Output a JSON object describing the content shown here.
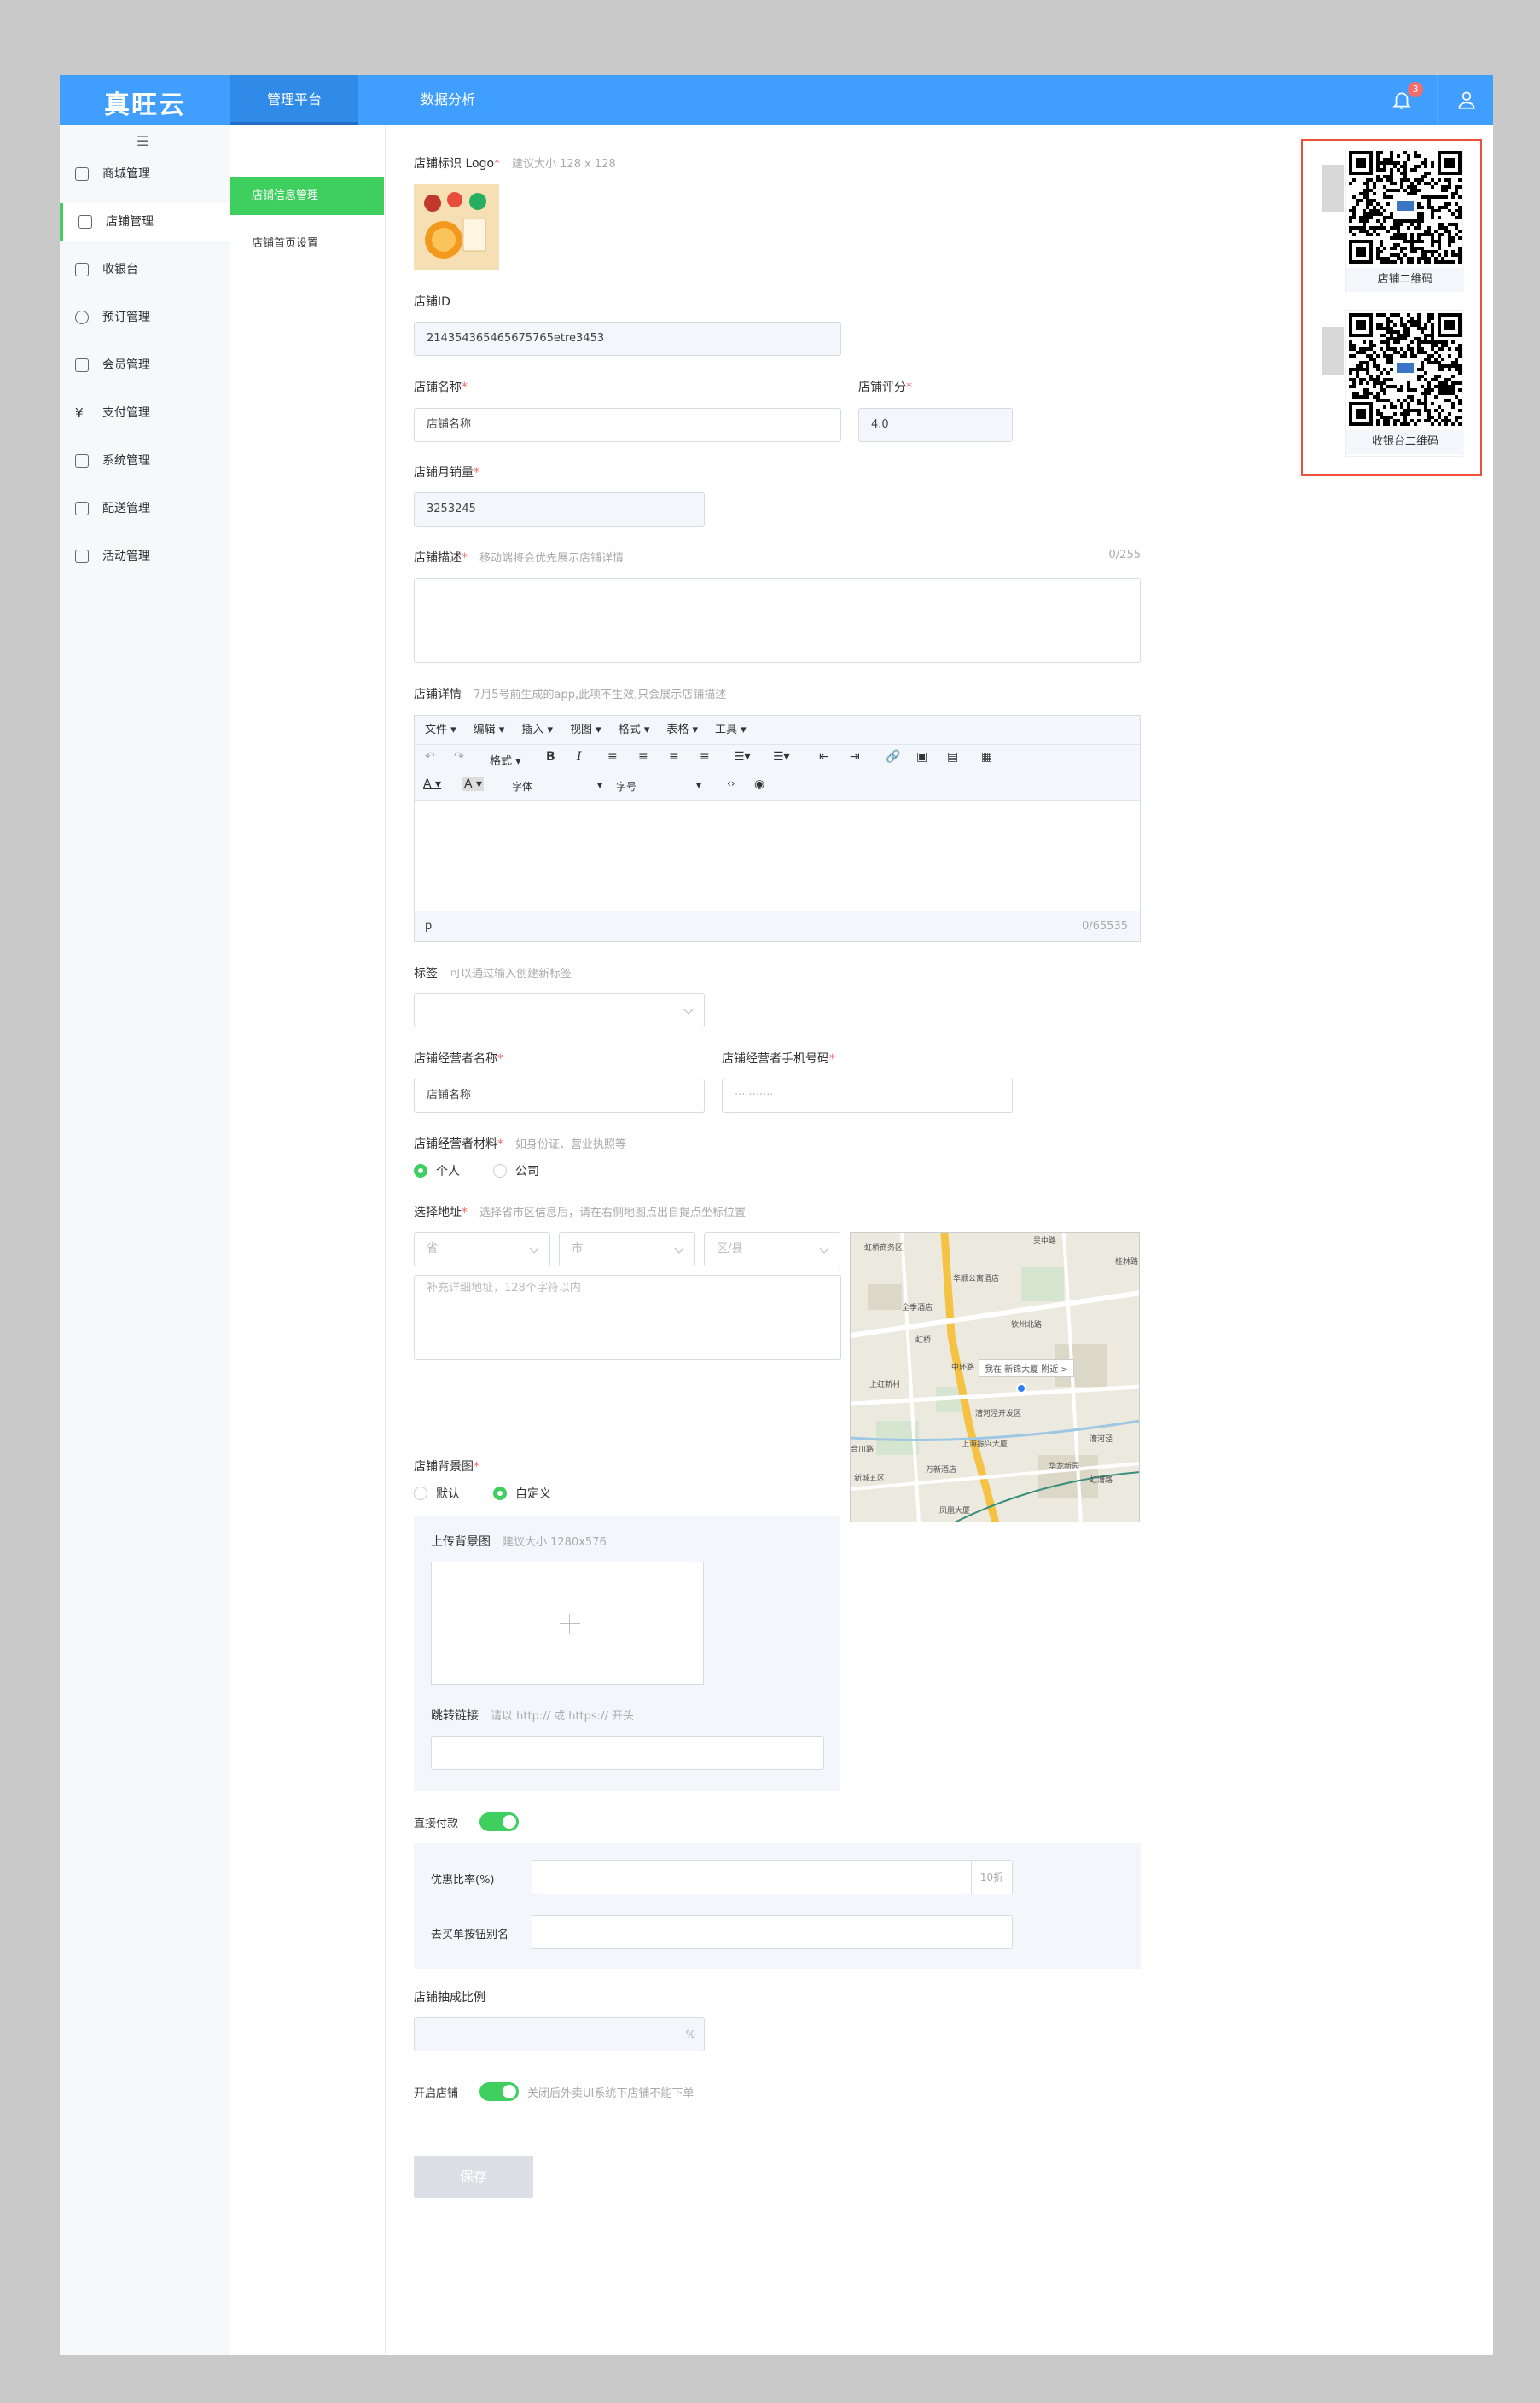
{
  "header": {
    "logo": "真旺云",
    "nav": [
      "管理平台",
      "数据分析"
    ],
    "notification_count": "3"
  },
  "sidebar": {
    "items": [
      {
        "label": "商城管理",
        "icon": "shop-icon"
      },
      {
        "label": "店铺管理",
        "icon": "store-icon"
      },
      {
        "label": "收银台",
        "icon": "cashier-icon"
      },
      {
        "label": "预订管理",
        "icon": "clock-icon"
      },
      {
        "label": "会员管理",
        "icon": "crown-icon"
      },
      {
        "label": "支付管理",
        "icon": "yen-icon"
      },
      {
        "label": "系统管理",
        "icon": "wrench-icon"
      },
      {
        "label": "配送管理",
        "icon": "truck-icon"
      },
      {
        "label": "活动管理",
        "icon": "gift-icon"
      }
    ]
  },
  "subnav": {
    "items": [
      "店铺信息管理",
      "店铺首页设置"
    ]
  },
  "form": {
    "logo_label": "店铺标识 Logo",
    "logo_hint": "建议大小 128 x 128",
    "id_label": "店铺ID",
    "id_value": "214354365465675765etre3453",
    "name_label": "店铺名称",
    "name_value": "店铺名称",
    "score_label": "店铺评分",
    "score_value": "4.0",
    "sales_label": "店铺月销量",
    "sales_value": "3253245",
    "desc_label": "店铺描述",
    "desc_hint": "移动端将会优先展示店铺详情",
    "desc_count": "0/255",
    "detail_label": "店铺详情",
    "detail_hint": "7月5号前生成的app,此项不生效,只会展示店铺描述",
    "editor_menu": [
      "文件 ▾",
      "编辑 ▾",
      "插入 ▾",
      "视图 ▾",
      "格式 ▾",
      "表格 ▾",
      "工具 ▾"
    ],
    "editor_format": "格式 ▾",
    "editor_font": "字体",
    "editor_size": "字号",
    "editor_status": "p",
    "editor_count": "0/65535",
    "tag_label": "标签",
    "tag_hint": "可以通过输入创建新标签",
    "operator_label": "店铺经营者名称",
    "operator_value": "店铺名称",
    "phone_label": "店铺经营者手机号码",
    "phone_placeholder": "···········",
    "material_label": "店铺经营者材料",
    "material_hint": "如身份证、营业执照等",
    "material_options": [
      "个人",
      "公司"
    ],
    "address_label": "选择地址",
    "address_hint": "选择省市区信息后，请在右侧地图点出自提点坐标位置",
    "province_placeholder": "省",
    "city_placeholder": "市",
    "district_placeholder": "区/县",
    "address_detail_placeholder": "补充详细地址，128个字符以内",
    "bg_label": "店铺背景图",
    "bg_options": [
      "默认",
      "自定义"
    ],
    "upload_bg_label": "上传背景图",
    "upload_bg_hint": "建议大小 1280x576",
    "jump_label": "跳转链接",
    "jump_hint": "请以 http:// 或 https:// 开头",
    "direct_pay_label": "直接付款",
    "discount_label": "优惠比率(%)",
    "discount_suffix": "10折",
    "button_alias_label": "去买单按钮别名",
    "commission_label": "店铺抽成比例",
    "commission_suffix": "%",
    "open_label": "开启店铺",
    "open_hint": "关闭后外卖UI系统下店铺不能下单",
    "save": "保存"
  },
  "map": {
    "labels": [
      "虹桥商务区",
      "吴中路",
      "华顺公寓酒店",
      "桂林路",
      "全季酒店",
      "虹桥",
      "钦州北路",
      "中环路",
      "我在 新锦大厦 附近 >",
      "上虹新村",
      "漕河泾开发区",
      "上海振兴大厦",
      "万新酒店",
      "漕河泾",
      "新城五区",
      "华龙新园",
      "凤凰大厦",
      "虹漕路",
      "合川路"
    ]
  },
  "qr": {
    "store_label": "店铺二维码",
    "cashier_label": "收银台二维码"
  }
}
